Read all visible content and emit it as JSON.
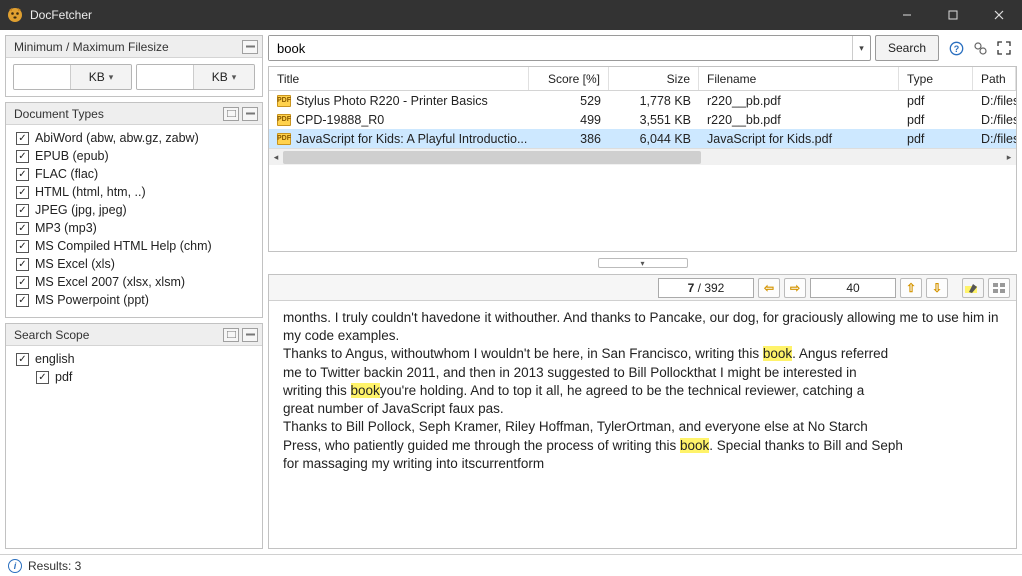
{
  "window": {
    "title": "DocFetcher"
  },
  "sidebar": {
    "filesize": {
      "title": "Minimum / Maximum Filesize",
      "min_value": "",
      "min_unit": "KB",
      "max_value": "",
      "max_unit": "KB"
    },
    "doctypes": {
      "title": "Document Types",
      "items": [
        {
          "label": "AbiWord (abw, abw.gz, zabw)",
          "checked": true
        },
        {
          "label": "EPUB (epub)",
          "checked": true
        },
        {
          "label": "FLAC (flac)",
          "checked": true
        },
        {
          "label": "HTML (html, htm, ..)",
          "checked": true
        },
        {
          "label": "JPEG (jpg, jpeg)",
          "checked": true
        },
        {
          "label": "MP3 (mp3)",
          "checked": true
        },
        {
          "label": "MS Compiled HTML Help (chm)",
          "checked": true
        },
        {
          "label": "MS Excel (xls)",
          "checked": true
        },
        {
          "label": "MS Excel 2007 (xlsx, xlsm)",
          "checked": true
        },
        {
          "label": "MS Powerpoint (ppt)",
          "checked": true
        }
      ]
    },
    "scope": {
      "title": "Search Scope",
      "items": [
        {
          "label": "english",
          "checked": true,
          "depth": 0
        },
        {
          "label": "pdf",
          "checked": true,
          "depth": 1
        }
      ]
    }
  },
  "search": {
    "query": "book",
    "button": "Search"
  },
  "results": {
    "columns": {
      "title": "Title",
      "score": "Score [%]",
      "size": "Size",
      "filename": "Filename",
      "type": "Type",
      "path": "Path"
    },
    "rows": [
      {
        "title": "Stylus Photo R220 - Printer Basics",
        "score": "529",
        "size": "1,778 KB",
        "filename": "r220__pb.pdf",
        "type": "pdf",
        "path": "D:/files/p",
        "selected": false
      },
      {
        "title": "CPD-19888_R0",
        "score": "499",
        "size": "3,551 KB",
        "filename": "r220__bb.pdf",
        "type": "pdf",
        "path": "D:/files/p",
        "selected": false
      },
      {
        "title": "JavaScript for Kids: A Playful Introductio...",
        "score": "386",
        "size": "6,044 KB",
        "filename": "JavaScript for Kids.pdf",
        "type": "pdf",
        "path": "D:/files/p",
        "selected": true
      }
    ]
  },
  "preview": {
    "page_current": "7",
    "page_total": "392",
    "occurrence": "40",
    "text_segments": [
      {
        "t": "months.   I   truly couldn't   havedone   it  withouther.  And thanks to Pancake, our   dog, for   graciously allowing   me   to use  him  in my   code   examples."
      },
      {
        "t": "Thanks   to Angus, withoutwhom  I   wouldn't  be   here,   in San Francisco,   writing this  "
      },
      {
        "t": "book",
        "hl": true
      },
      {
        "t": ".   Angus referred"
      },
      {
        "t": "me   to Twitter backin 2011,   and then in 2013    suggested   to Bill  Pollockthat I   might   be   interested in"
      },
      {
        "t": "writing this  "
      },
      {
        "t": "book",
        "hl": true
      },
      {
        "t": "you're  holding.    And to top   it  all,    he   agreed to be    the   technical reviewer, catching  a"
      },
      {
        "t": "great    number   of JavaScript   faux pas."
      },
      {
        "t": "Thanks   to Bill  Pollock,   Seph   Kramer,  Riley    Hoffman, TylerOrtman,   and everyone else at No   Starch"
      },
      {
        "t": "Press, who patiently  guided me   through    the   process   of writing this  "
      },
      {
        "t": "book",
        "hl": true
      },
      {
        "t": ".    Special    thanks to Bill and  Seph"
      },
      {
        "t": "for   massaging   my   writing  into   itscurrentform"
      }
    ]
  },
  "status": {
    "results_label": "Results: 3"
  }
}
